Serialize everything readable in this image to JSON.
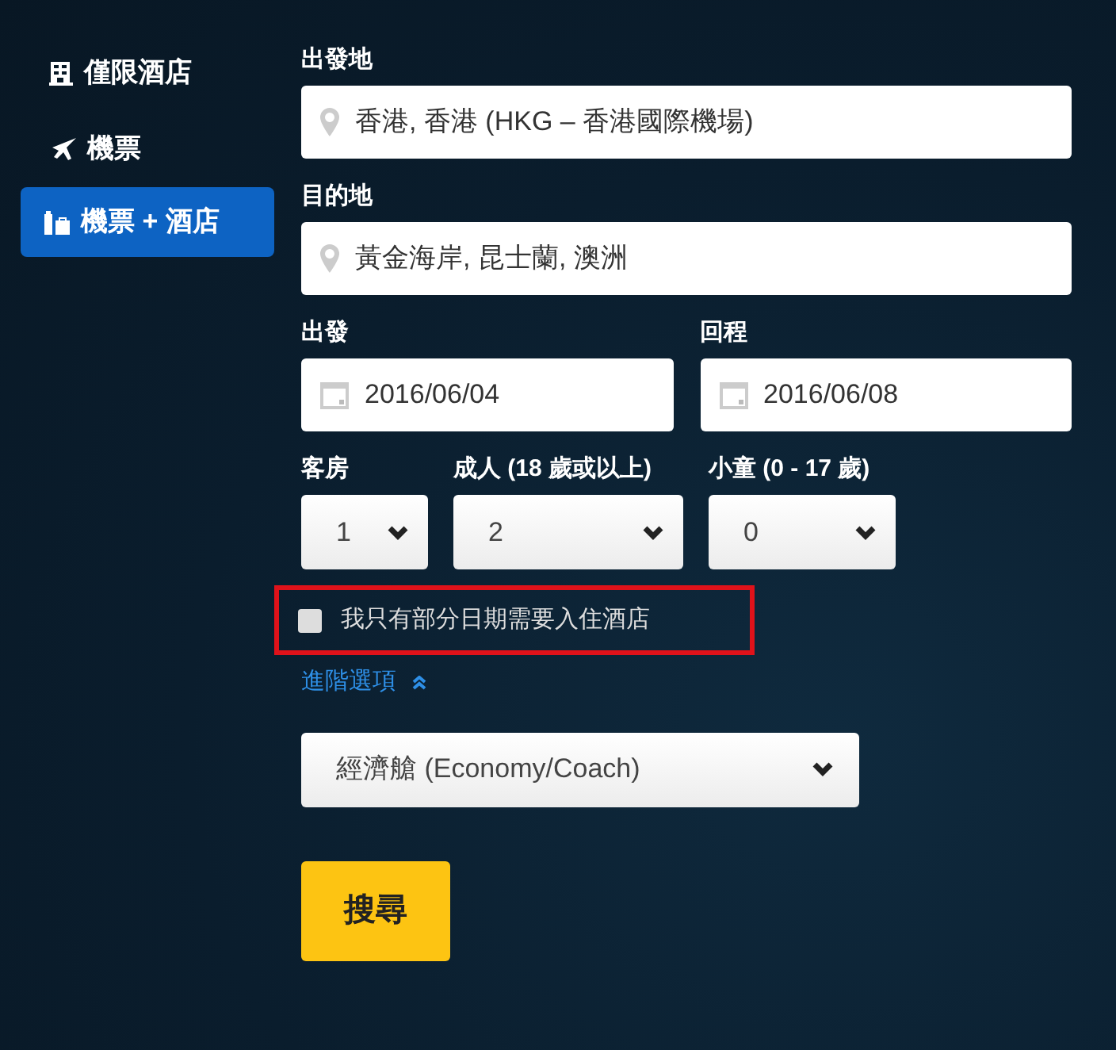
{
  "sidebar": {
    "items": [
      {
        "label": "僅限酒店",
        "kind": "hotel",
        "selected": false
      },
      {
        "label": "機票",
        "kind": "flight",
        "selected": false
      },
      {
        "label": "機票 + 酒店",
        "kind": "package",
        "selected": true
      }
    ]
  },
  "form": {
    "origin": {
      "label": "出發地",
      "value": "香港, 香港 (HKG – 香港國際機場)"
    },
    "destination": {
      "label": "目的地",
      "value": "黃金海岸, 昆士蘭, 澳洲"
    },
    "dates": [
      {
        "label": "出發",
        "value": "2016/06/04"
      },
      {
        "label": "回程",
        "value": "2016/06/08"
      }
    ],
    "counts": [
      {
        "label": "客房",
        "value": "1"
      },
      {
        "label": "成人 (18 歲或以上)",
        "value": "2"
      },
      {
        "label": "小童 (0 - 17 歲)",
        "value": "0"
      }
    ],
    "partial_stay": {
      "label": "我只有部分日期需要入住酒店",
      "checked": false,
      "highlighted": true
    },
    "advanced_link": {
      "label": "進階選項",
      "expanded": true
    },
    "cabin": {
      "value": "經濟艙 (Economy/Coach)"
    },
    "search_button": "搜尋"
  }
}
